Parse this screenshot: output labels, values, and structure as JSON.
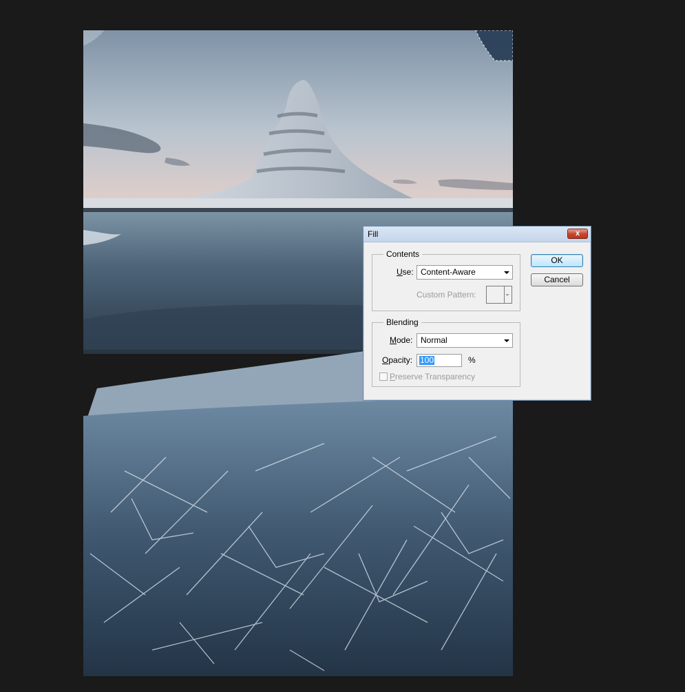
{
  "dialog": {
    "title": "Fill",
    "close_label": "x",
    "contents": {
      "group_label": "Contents",
      "use_label_prefix": "U",
      "use_label_rest": "se:",
      "use_value": "Content-Aware",
      "custom_pattern_label": "Custom Pattern:"
    },
    "blending": {
      "group_label": "Blending",
      "mode_label_prefix": "M",
      "mode_label_rest": "ode:",
      "mode_value": "Normal",
      "opacity_label_prefix": "O",
      "opacity_label_rest": "pacity:",
      "opacity_value": "100",
      "opacity_unit": "%",
      "preserve_label_prefix": "P",
      "preserve_label_rest": "reserve Transparency",
      "preserve_checked": false
    },
    "ok_label": "OK",
    "cancel_label": "Cancel"
  },
  "colors": {
    "workspace": "#1a1a1a",
    "dialog_bg": "#f0f0f0",
    "selection_highlight": "#3399ff"
  }
}
